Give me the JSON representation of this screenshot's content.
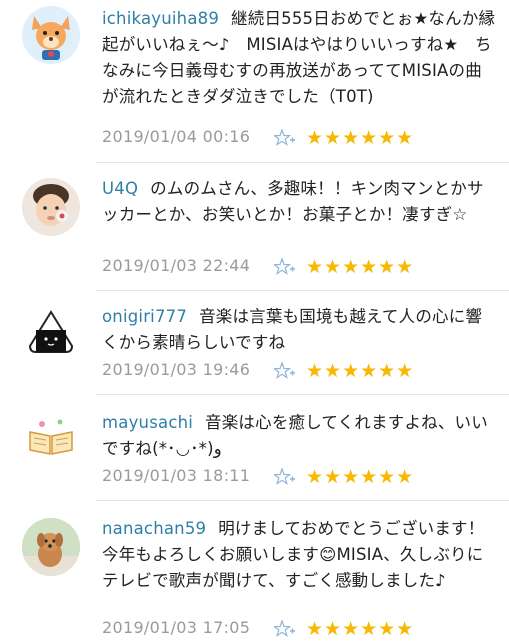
{
  "comments": [
    {
      "username": "ichikayuiha89",
      "text": "継続日555日おめでとぉ★なんか縁起がいいねぇ〜♪　MISIAはやはりいいっすね★　ちなみに今日義母むすの再放送があっててMISIAの曲が流れたときダダ泣きでした（T0T)",
      "date": "2019/01/04 00:16",
      "stars": "★★★★★★",
      "avatar_icon": "dog-character-icon"
    },
    {
      "username": "U4Q",
      "text": "のムのムさん、多趣味！！キン肉マンとかサッカーとか、お笑いとか！お菓子とか！凄すぎ☆",
      "date": "2019/01/03 22:44",
      "stars": "★★★★★★",
      "avatar_icon": "child-photo-icon"
    },
    {
      "username": "onigiri777",
      "text": "音楽は言葉も国境も越えて人の心に響くから素晴らしいですね",
      "date": "2019/01/03 19:46",
      "stars": "★★★★★★",
      "avatar_icon": "onigiri-icon"
    },
    {
      "username": "mayusachi",
      "text": "音楽は心を癒してくれますよね、いいですね(*･◡･*)ﻭ",
      "date": "2019/01/03 18:11",
      "stars": "★★★★★★",
      "avatar_icon": "open-book-icon"
    },
    {
      "username": "nanachan59",
      "text": "明けましておめでとうございます！今年もよろしくお願いします😊MISIA、久しぶりにテレビで歌声が聞けて、すごく感動しました♪",
      "date": "2019/01/03 17:05",
      "stars": "★★★★★★",
      "avatar_icon": "dog-photo-icon"
    }
  ],
  "colors": {
    "username": "#2e7fa6",
    "date": "#9a9a9a",
    "star": "#f6b800",
    "add_star": "#8fb4d8"
  }
}
